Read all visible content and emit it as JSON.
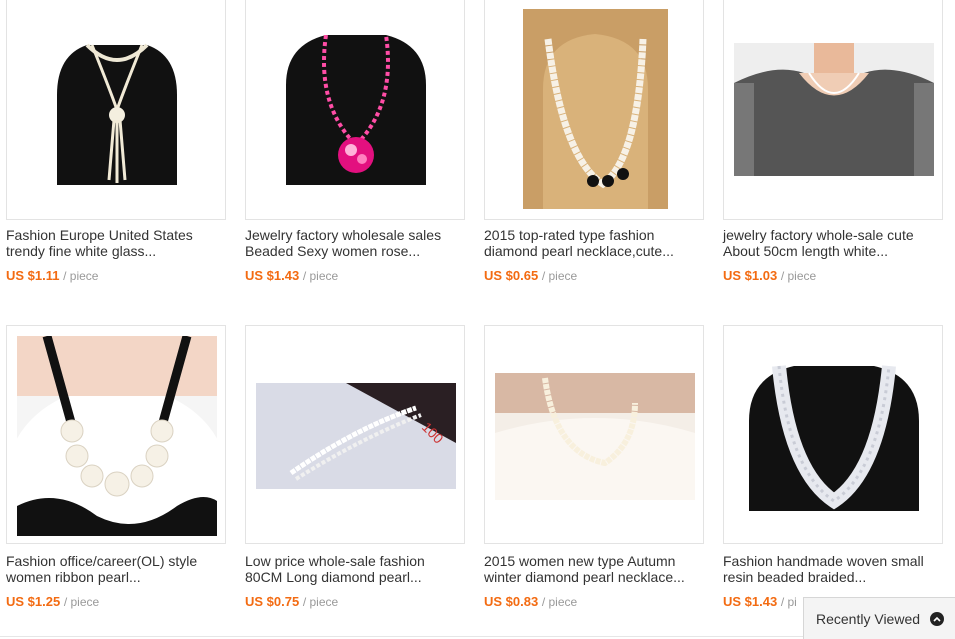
{
  "products": [
    {
      "title_line1": "Fashion Europe United States",
      "title_line2": "trendy fine white glass...",
      "price": "US $1.11",
      "unit": "/ piece",
      "image": "white beaded knotted necklace on black bust"
    },
    {
      "title_line1": "Jewelry factory wholesale sales",
      "title_line2": "Beaded Sexy women rose...",
      "price": "US $1.43",
      "unit": "/ piece",
      "image": "pink beaded rose pendant necklace on black bust"
    },
    {
      "title_line1": "2015 top-rated type fashion",
      "title_line2": "diamond pearl necklace,cute...",
      "price": "US $0.65",
      "unit": "/ piece",
      "image": "graduated pearl necklace on cork bust"
    },
    {
      "title_line1": "jewelry factory whole-sale cute",
      "title_line2": "About 50cm length white...",
      "price": "US $1.03",
      "unit": "/ piece",
      "image": "woman wearing short pearl necklace"
    },
    {
      "title_line1": "Fashion office/career(OL) style",
      "title_line2": "women ribbon pearl...",
      "price": "US $1.25",
      "unit": "/ piece",
      "image": "large pearl necklace with black ribbon"
    },
    {
      "title_line1": "Low price whole-sale fashion",
      "title_line2": "80CM Long diamond pearl...",
      "price": "US $0.75",
      "unit": "/ piece",
      "image": "long pearl necklace on magazine"
    },
    {
      "title_line1": "2015 women new type Autumn",
      "title_line2": "winter diamond pearl necklace...",
      "price": "US $0.83",
      "unit": "/ piece",
      "image": "woman wearing pearl necklace on lace top"
    },
    {
      "title_line1": "Fashion handmade woven small",
      "title_line2": "resin beaded braided...",
      "price": "US $1.43",
      "unit": "/ pi",
      "image": "white braided beaded necklace on black bust"
    }
  ],
  "recently_viewed": {
    "label": "Recently Viewed",
    "icon": "chevron-up-circle-icon"
  }
}
